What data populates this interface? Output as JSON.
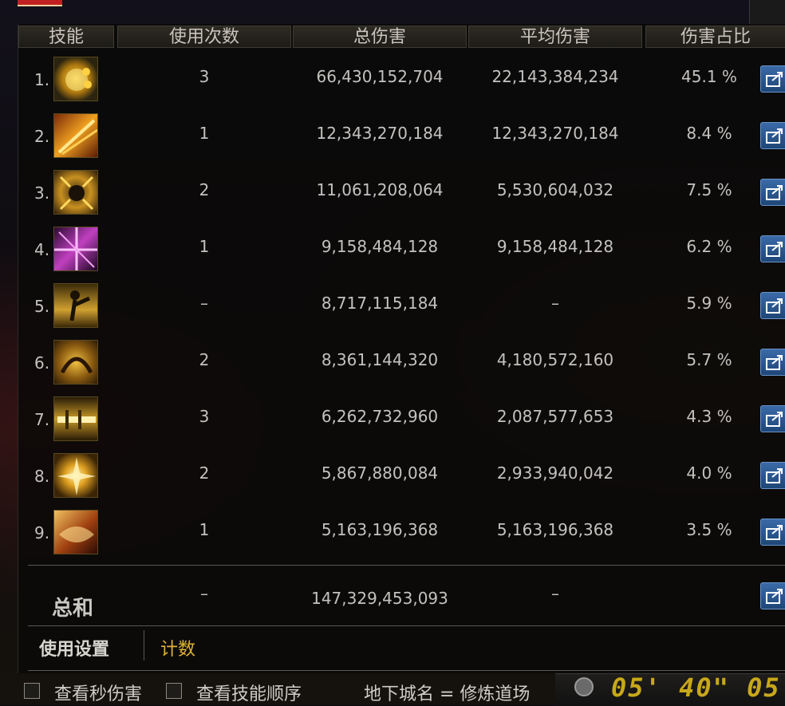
{
  "header": {
    "col_skill": "技能",
    "col_uses": "使用次数",
    "col_total": "总伤害",
    "col_avg": "平均伤害",
    "col_pct": "伤害占比"
  },
  "rows": [
    {
      "index": "1.",
      "uses": "3",
      "total": "66,430,152,704",
      "avg": "22,143,384,234",
      "pct": "45.1 %"
    },
    {
      "index": "2.",
      "uses": "1",
      "total": "12,343,270,184",
      "avg": "12,343,270,184",
      "pct": "8.4 %"
    },
    {
      "index": "3.",
      "uses": "2",
      "total": "11,061,208,064",
      "avg": "5,530,604,032",
      "pct": "7.5 %"
    },
    {
      "index": "4.",
      "uses": "1",
      "total": "9,158,484,128",
      "avg": "9,158,484,128",
      "pct": "6.2 %"
    },
    {
      "index": "5.",
      "uses": "–",
      "total": "8,717,115,184",
      "avg": "–",
      "pct": "5.9 %"
    },
    {
      "index": "6.",
      "uses": "2",
      "total": "8,361,144,320",
      "avg": "4,180,572,160",
      "pct": "5.7 %"
    },
    {
      "index": "7.",
      "uses": "3",
      "total": "6,262,732,960",
      "avg": "2,087,577,653",
      "pct": "4.3 %"
    },
    {
      "index": "8.",
      "uses": "2",
      "total": "5,867,880,084",
      "avg": "2,933,940,042",
      "pct": "4.0 %"
    },
    {
      "index": "9.",
      "uses": "1",
      "total": "5,163,196,368",
      "avg": "5,163,196,368",
      "pct": "3.5 %"
    }
  ],
  "summary": {
    "label": "总和",
    "uses": "–",
    "total": "147,329,453,093",
    "avg": "–"
  },
  "tabs": {
    "settings": "使用设置",
    "count": "计数"
  },
  "bottom": {
    "per_second_label": "查看秒伤害",
    "skill_order_label": "查看技能顺序",
    "dungeon": "地下城名 = 修炼道场",
    "timer": "05' 40\" 05"
  },
  "colors": {
    "accent_gold": "#e0b23a",
    "share_blue": "#2a5a98"
  }
}
